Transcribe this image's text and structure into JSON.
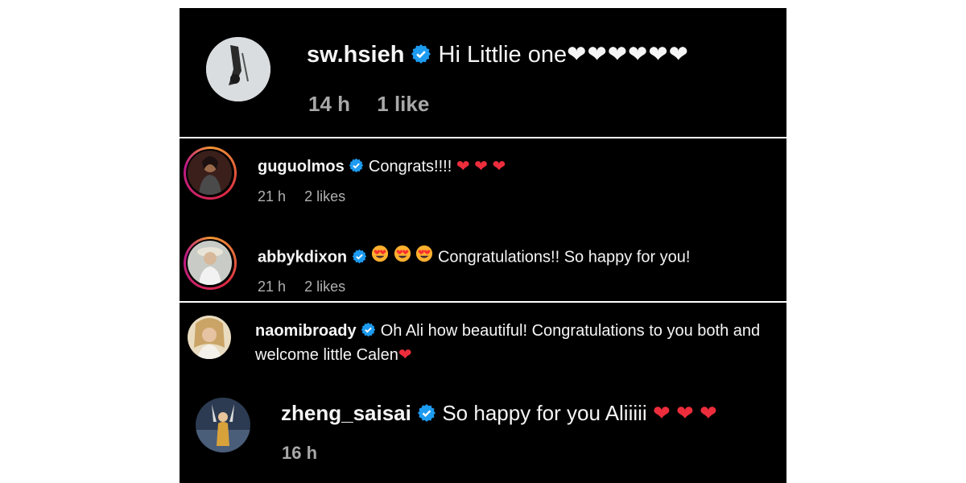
{
  "comments": [
    {
      "username": "sw.hsieh",
      "verified": true,
      "text": "Hi Littlie one",
      "trailing_hearts": "❤︎❤︎❤︎❤︎❤︎❤︎",
      "time": "14 h",
      "likes": "1 like"
    },
    {
      "username": "guguolmos",
      "verified": true,
      "text": "Congrats!!!!",
      "trailing_hearts": "❤︎ ❤︎ ❤︎",
      "time": "21 h",
      "likes": "2 likes"
    },
    {
      "username": "abbykdixon",
      "verified": true,
      "leading_emoji": [
        "heart-eyes-emoji",
        "heart-eyes-emoji",
        "heart-eyes-emoji"
      ],
      "text": "Congratulations!! So happy for you!",
      "time": "21 h",
      "likes": "2 likes"
    },
    {
      "username": "naomibroady",
      "verified": true,
      "text": "Oh Ali how beautiful! Congratulations to you both and welcome little Calen",
      "trailing_hearts": "❤︎"
    },
    {
      "username": "zheng_saisai",
      "verified": true,
      "text": "So happy for you Aliiiii",
      "trailing_hearts": "❤︎ ❤︎ ❤︎",
      "time": "16 h"
    }
  ],
  "colors": {
    "background": "#000000",
    "text": "#f5f5f5",
    "meta": "#a8a8a8",
    "verified": "#1d9bf0",
    "heart_red": "#ed2d3c",
    "heart_white": "#ffffff"
  },
  "icons": [
    "verified-badge-icon",
    "heart-icon",
    "heart-eyes-emoji"
  ]
}
